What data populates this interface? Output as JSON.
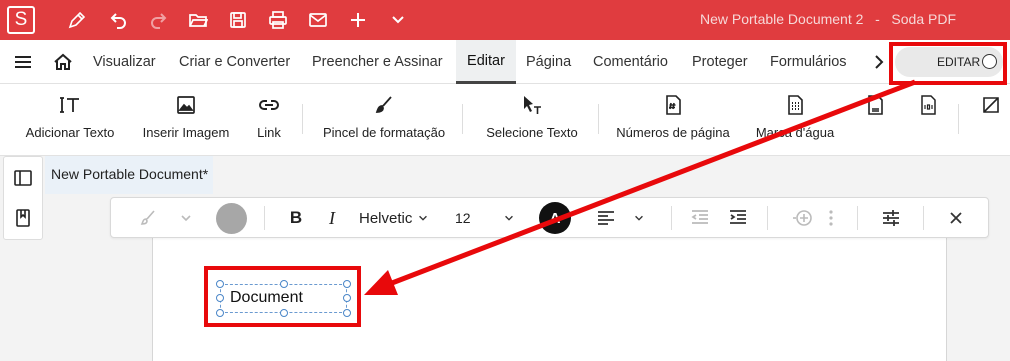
{
  "app": {
    "logo_letter": "S",
    "window_title": "New Portable Document 2   -   Soda PDF",
    "brand_color": "#e03c3f"
  },
  "quick_toolbar": {
    "icons": [
      "pen-icon",
      "undo-icon",
      "redo-icon",
      "open-folder-icon",
      "save-icon",
      "print-icon",
      "mail-icon",
      "plus-icon",
      "chevron-down-icon"
    ]
  },
  "menu": {
    "items": [
      {
        "label": "Visualizar"
      },
      {
        "label": "Criar e Converter"
      },
      {
        "label": "Preencher e Assinar"
      },
      {
        "label": "Editar",
        "active": true
      },
      {
        "label": "Página"
      },
      {
        "label": "Comentário"
      },
      {
        "label": "Proteger"
      },
      {
        "label": "Formulários"
      }
    ],
    "edit_toggle_label": "EDITAR"
  },
  "ribbon": {
    "items": [
      {
        "label": "Adicionar Texto",
        "icon": "add-text-icon"
      },
      {
        "label": "Inserir Imagem",
        "icon": "image-icon"
      },
      {
        "label": "Link",
        "icon": "link-icon"
      },
      {
        "label": "Pincel de formatação",
        "icon": "format-brush-icon"
      },
      {
        "label": "Selecione Texto",
        "icon": "select-text-icon"
      },
      {
        "label": "Números de página",
        "icon": "page-number-icon"
      },
      {
        "label": "Marca d'água",
        "icon": "watermark-icon"
      }
    ]
  },
  "document_tab": {
    "title": "New Portable Document*"
  },
  "format_bar": {
    "font_name": "Helvetic",
    "font_size": "12",
    "text_color_letter": "A"
  },
  "textbox": {
    "text": "Document"
  },
  "annotation": {
    "color": "#e8090b"
  }
}
